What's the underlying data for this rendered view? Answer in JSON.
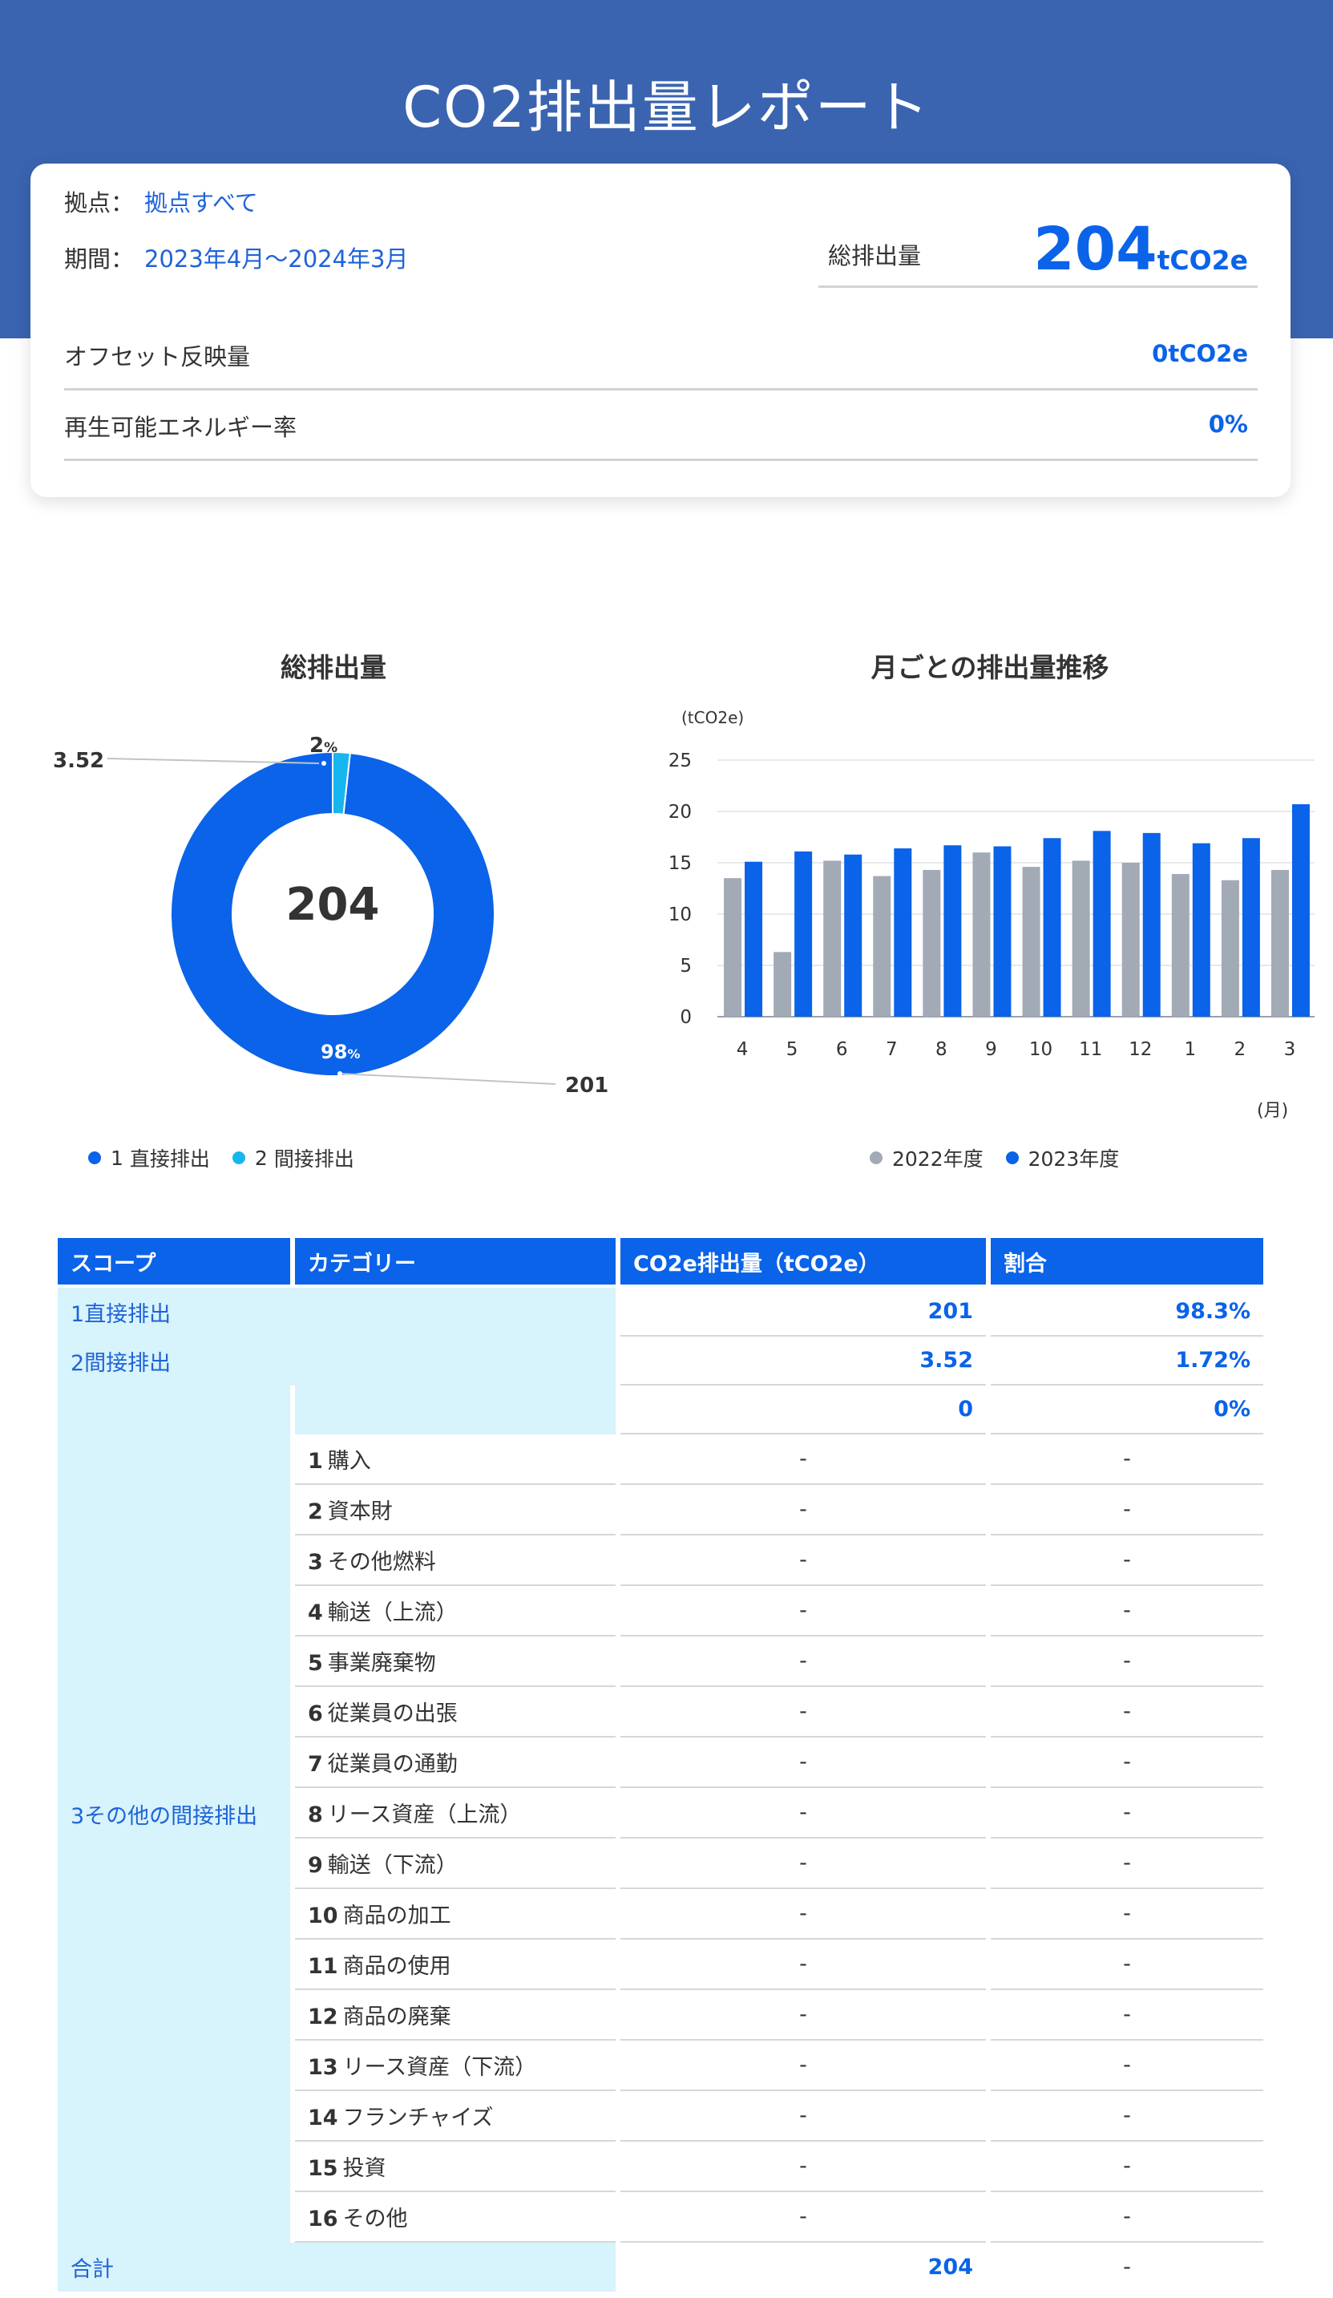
{
  "header": {
    "title": "CO2排出量レポート"
  },
  "summary": {
    "site_label": "拠点：",
    "site_value": "拠点すべて",
    "period_label": "期間：",
    "period_value": "2023年4月〜2024年3月",
    "total_label": "総排出量",
    "total_value": "204",
    "total_unit": "tCO2e",
    "offset_label": "オフセット反映量",
    "offset_value": "0tCO2e",
    "renewable_label": "再生可能エネルギー率",
    "renewable_value": "0%"
  },
  "donut": {
    "title": "総排出量",
    "center_value": "204",
    "callout_small_value": "3.52",
    "callout_large_value": "201",
    "small_pct": "2",
    "large_pct": "98",
    "pct_sign": "%",
    "legend": [
      {
        "num": "1",
        "label": "直接排出",
        "color": "#0a63e8"
      },
      {
        "num": "2",
        "label": "間接排出",
        "color": "#17b6ee"
      }
    ]
  },
  "bar": {
    "title": "月ごとの排出量推移",
    "unit_label": "(tCO2e)",
    "x_unit_label": "(月)",
    "legend": [
      {
        "label": "2022年度",
        "color": "#a2aab6"
      },
      {
        "label": "2023年度",
        "color": "#0a63e8"
      }
    ]
  },
  "chart_data": [
    {
      "type": "pie",
      "title": "総排出量",
      "labels": [
        "1 直接排出",
        "2 間接排出"
      ],
      "values": [
        201,
        3.52
      ],
      "percent_labels": [
        "98%",
        "2%"
      ],
      "center_label": "204",
      "donut": true,
      "colors": [
        "#0a63e8",
        "#17b6ee"
      ]
    },
    {
      "type": "bar",
      "title": "月ごとの排出量推移",
      "ylabel": "(tCO2e)",
      "xlabel": "(月)",
      "categories": [
        "4",
        "5",
        "6",
        "7",
        "8",
        "9",
        "10",
        "11",
        "12",
        "1",
        "2",
        "3"
      ],
      "series": [
        {
          "name": "2022年度",
          "values": [
            13.5,
            6.3,
            15.2,
            13.7,
            14.3,
            16.0,
            14.6,
            15.2,
            15.0,
            13.9,
            13.3,
            14.3
          ],
          "color": "#a2aab6"
        },
        {
          "name": "2023年度",
          "values": [
            15.1,
            16.1,
            15.8,
            16.4,
            16.7,
            16.6,
            17.4,
            18.1,
            17.9,
            16.9,
            17.4,
            20.7
          ],
          "color": "#0a63e8"
        }
      ],
      "ylim": [
        0,
        25
      ],
      "yticks": [
        0,
        5,
        10,
        15,
        20,
        25
      ],
      "grid": true,
      "legend_position": "bottom"
    }
  ],
  "table": {
    "headers": [
      "スコープ",
      "カテゴリー",
      "CO2e排出量（tCO2e）",
      "割合"
    ],
    "scope1": {
      "label": "1直接排出",
      "value": "201",
      "ratio": "98.3%"
    },
    "scope2": {
      "label": "2間接排出",
      "value": "3.52",
      "ratio": "1.72%"
    },
    "scope3": {
      "label": "3その他の間接排出",
      "value": "0",
      "ratio": "0%",
      "categories": [
        {
          "num": "1",
          "name": "購入",
          "value": "-",
          "ratio": "-"
        },
        {
          "num": "2",
          "name": "資本財",
          "value": "-",
          "ratio": "-"
        },
        {
          "num": "3",
          "name": "その他燃料",
          "value": "-",
          "ratio": "-"
        },
        {
          "num": "4",
          "name": "輸送（上流）",
          "value": "-",
          "ratio": "-"
        },
        {
          "num": "5",
          "name": "事業廃棄物",
          "value": "-",
          "ratio": "-"
        },
        {
          "num": "6",
          "name": "従業員の出張",
          "value": "-",
          "ratio": "-"
        },
        {
          "num": "7",
          "name": "従業員の通勤",
          "value": "-",
          "ratio": "-"
        },
        {
          "num": "8",
          "name": "リース資産（上流）",
          "value": "-",
          "ratio": "-"
        },
        {
          "num": "9",
          "name": "輸送（下流）",
          "value": "-",
          "ratio": "-"
        },
        {
          "num": "10",
          "name": "商品の加工",
          "value": "-",
          "ratio": "-"
        },
        {
          "num": "11",
          "name": "商品の使用",
          "value": "-",
          "ratio": "-"
        },
        {
          "num": "12",
          "name": "商品の廃棄",
          "value": "-",
          "ratio": "-"
        },
        {
          "num": "13",
          "name": "リース資産（下流）",
          "value": "-",
          "ratio": "-"
        },
        {
          "num": "14",
          "name": "フランチャイズ",
          "value": "-",
          "ratio": "-"
        },
        {
          "num": "15",
          "name": "投資",
          "value": "-",
          "ratio": "-"
        },
        {
          "num": "16",
          "name": "その他",
          "value": "-",
          "ratio": "-"
        }
      ]
    },
    "total": {
      "label": "合計",
      "value": "204",
      "ratio": "-"
    }
  }
}
